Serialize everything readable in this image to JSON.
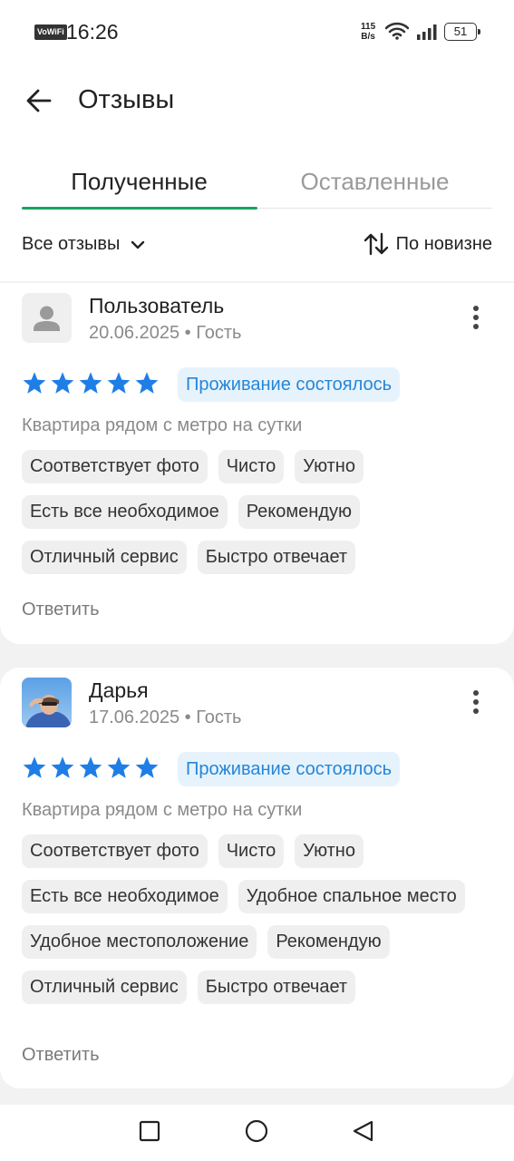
{
  "status_bar": {
    "vowifi": "VoWiFi",
    "time": "16:26",
    "net_speed_value": "115",
    "net_speed_unit": "B/s",
    "battery": "51"
  },
  "header": {
    "title": "Отзывы"
  },
  "tabs": [
    {
      "label": "Полученные",
      "active": true
    },
    {
      "label": "Оставленные",
      "active": false
    }
  ],
  "filters": {
    "scope_label": "Все отзывы",
    "sort_label": "По новизне"
  },
  "reviews": [
    {
      "author": "Пользователь",
      "meta": "20.06.2025 • Гость",
      "rating": 5,
      "stay_badge": "Проживание состоялось",
      "listing": "Квартира рядом с метро на сутки",
      "tags": [
        "Соответствует фото",
        "Чисто",
        "Уютно",
        "Есть все необходимое",
        "Рекомендую",
        "Отличный сервис",
        "Быстро отвечает"
      ],
      "reply_label": "Ответить"
    },
    {
      "author": "Дарья",
      "meta": "17.06.2025 • Гость",
      "rating": 5,
      "stay_badge": "Проживание состоялось",
      "listing": "Квартира рядом с метро на сутки",
      "tags": [
        "Соответствует фото",
        "Чисто",
        "Уютно",
        "Есть все необходимое",
        "Удобное спальное место",
        "Удобное местоположение",
        "Рекомендую",
        "Отличный сервис",
        "Быстро отвечает"
      ],
      "reply_label": "Ответить"
    }
  ],
  "colors": {
    "accent": "#1aa260",
    "star": "#1f7ee6",
    "badge_text": "#2486d9",
    "badge_bg": "#e7f3fc"
  }
}
